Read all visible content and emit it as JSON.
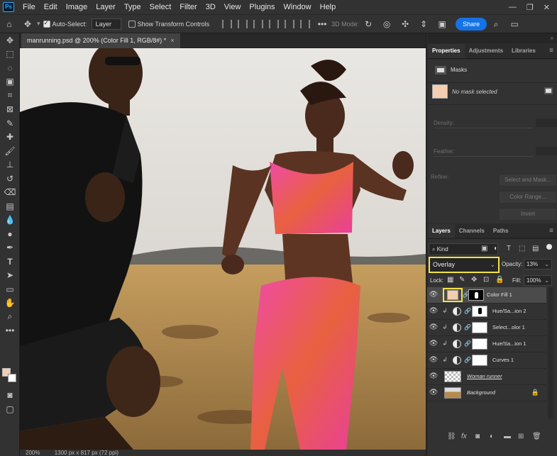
{
  "app": {
    "logo": "Ps"
  },
  "menu": [
    "File",
    "Edit",
    "Image",
    "Layer",
    "Type",
    "Select",
    "Filter",
    "3D",
    "View",
    "Plugins",
    "Window",
    "Help"
  ],
  "window_controls": {
    "minimize": "—",
    "restore": "❐",
    "close": "✕"
  },
  "options_bar": {
    "auto_select_label": "Auto-Select:",
    "auto_select_checked": true,
    "auto_select_target": "Layer",
    "transform_controls_label": "Show Transform Controls",
    "transform_controls_checked": false,
    "mode_3d_label": "3D Mode:",
    "share_label": "Share"
  },
  "document": {
    "tab_title": "manrunning.psd @ 200% (Color Fill 1, RGB/8#) *",
    "close_glyph": "×",
    "zoom_status": "200%",
    "size_status": "1300 px x 817 px (72 ppi)"
  },
  "colors": {
    "foreground": "#f3ceb0",
    "background": "#ffffff",
    "highlight": "#f5e245",
    "accent": "#1473e6"
  },
  "properties_panel": {
    "tabs": [
      "Properties",
      "Adjustments",
      "Libraries"
    ],
    "active_tab": "Properties",
    "section_label": "Masks",
    "mask_status": "No mask selected",
    "density_label": "Density:",
    "feather_label": "Feather:",
    "refine_label": "Refine:",
    "select_mask_label": "Select and Mask...",
    "color_range_label": "Color Range...",
    "invert_label": "Invert"
  },
  "layers_panel": {
    "tabs": [
      "Layers",
      "Channels",
      "Paths"
    ],
    "active_tab": "Layers",
    "filter_kind": "Kind",
    "blend_mode": "Overlay",
    "opacity_label": "Opacity:",
    "opacity_value": "13%",
    "lock_label": "Lock:",
    "fill_label": "Fill:",
    "fill_value": "100%",
    "layers": [
      {
        "name": "Color Fill 1",
        "selected": true
      },
      {
        "name": "Hue/Sa...ion 2",
        "selected": false
      },
      {
        "name": "Select...olor 1",
        "selected": false
      },
      {
        "name": "Hue/Sa...ion 1",
        "selected": false
      },
      {
        "name": "Curves 1",
        "selected": false
      },
      {
        "name": "Woman runner",
        "selected": false
      },
      {
        "name": "Background",
        "selected": false
      }
    ]
  }
}
